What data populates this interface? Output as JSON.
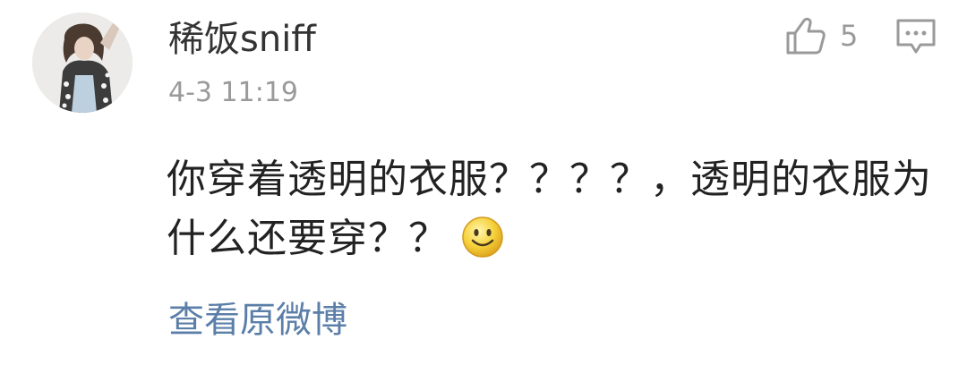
{
  "comment": {
    "username": "稀饭sniff",
    "timestamp": "4-3 11:19",
    "like_count": "5",
    "body": "你穿着透明的衣服？？？？，透明的衣服为什么还要穿？？",
    "view_original_link": "查看原微博"
  },
  "icons": {
    "like": "thumbs-up-icon",
    "reply": "comment-bubble-icon",
    "emoji": "smile-emoji-icon"
  },
  "colors": {
    "username": "#333333",
    "timestamp": "#9a9a9a",
    "body": "#222222",
    "link": "#5b7fa8",
    "icon": "#9a9a9a"
  }
}
